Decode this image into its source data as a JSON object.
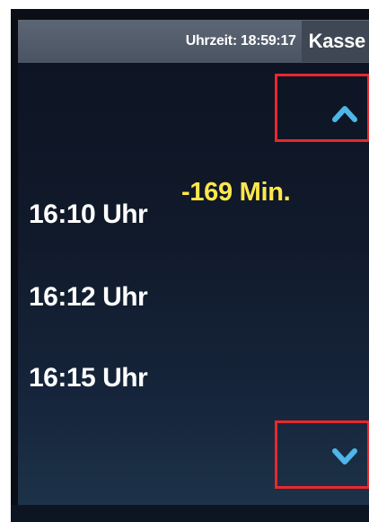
{
  "header": {
    "clock_text": "Uhrzeit: 18:59:17",
    "kasse_label": "Kasse"
  },
  "controls": {
    "scroll_up_icon": "chevron-up-icon",
    "scroll_down_icon": "chevron-down-icon"
  },
  "departures": [
    {
      "time": "16:10 Uhr",
      "delay": "-169 Min."
    },
    {
      "time": "16:12 Uhr"
    },
    {
      "time": "16:15 Uhr"
    }
  ],
  "colors": {
    "accent_chevron": "#4fb6e8",
    "delay_text": "#ffe84a",
    "highlight_border": "#e8282c"
  }
}
